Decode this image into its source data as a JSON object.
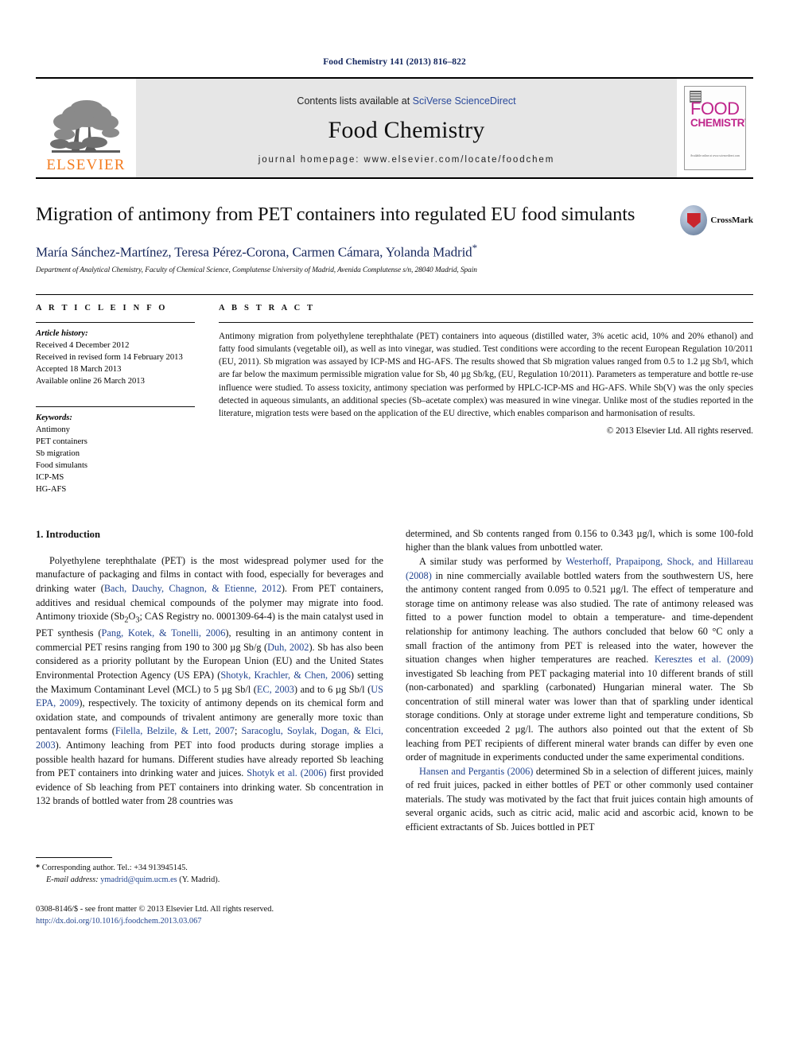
{
  "running_head": "Food Chemistry 141 (2013) 816–822",
  "masthead": {
    "publisher_name": "ELSEVIER",
    "contents_prefix": "Contents lists available at ",
    "contents_link": "SciVerse ScienceDirect",
    "journal_name": "Food Chemistry",
    "homepage": "journal homepage: www.elsevier.com/locate/foodchem",
    "cover": {
      "line1": "FOOD",
      "line2": "CHEMISTRY",
      "footline": "Available online at www.sciencedirect.com"
    }
  },
  "title_block": {
    "title": "Migration of antimony from PET containers into regulated EU food simulants",
    "authors": "María Sánchez-Martínez, Teresa Pérez-Corona, Carmen Cámara, Yolanda Madrid",
    "corresponding_marker": "*",
    "affiliation": "Department of Analytical Chemistry, Faculty of Chemical Science, Complutense University of Madrid, Avenida Complutense s/n, 28040 Madrid, Spain",
    "crossmark_label": "CrossMark"
  },
  "article_info": {
    "heading": "A R T I C L E   I N F O",
    "history_label": "Article history:",
    "history": [
      "Received 4 December 2012",
      "Received in revised form 14 February 2013",
      "Accepted 18 March 2013",
      "Available online 26 March 2013"
    ],
    "keywords_label": "Keywords:",
    "keywords": [
      "Antimony",
      "PET containers",
      "Sb migration",
      "Food simulants",
      "ICP-MS",
      "HG-AFS"
    ]
  },
  "abstract": {
    "heading": "A B S T R A C T",
    "text": "Antimony migration from polyethylene terephthalate (PET) containers into aqueous (distilled water, 3% acetic acid, 10% and 20% ethanol) and fatty food simulants (vegetable oil), as well as into vinegar, was studied. Test conditions were according to the recent European Regulation 10/2011 (EU, 2011). Sb migration was assayed by ICP-MS and HG-AFS. The results showed that Sb migration values ranged from 0.5 to 1.2 µg Sb/l, which are far below the maximum permissible migration value for Sb, 40 µg Sb/kg, (EU, Regulation 10/2011). Parameters as temperature and bottle re-use influence were studied. To assess toxicity, antimony speciation was performed by HPLC-ICP-MS and HG-AFS. While Sb(V) was the only species detected in aqueous simulants, an additional species (Sb–acetate complex) was measured in wine vinegar. Unlike most of the studies reported in the literature, migration tests were based on the application of the EU directive, which enables comparison and harmonisation of results.",
    "copyright": "© 2013 Elsevier Ltd. All rights reserved."
  },
  "body": {
    "section_heading": "1. Introduction",
    "left_col_paragraph": "Polyethylene terephthalate (PET) is the most widespread polymer used for the manufacture of packaging and films in contact with food, especially for beverages and drinking water (Bach, Dauchy, Chagnon, & Etienne, 2012). From PET containers, additives and residual chemical compounds of the polymer may migrate into food. Antimony trioxide (Sb2O3; CAS Registry no. 0001309-64-4) is the main catalyst used in PET synthesis (Pang, Kotek, & Tonelli, 2006), resulting in an antimony content in commercial PET resins ranging from 190 to 300 µg Sb/g (Duh, 2002). Sb has also been considered as a priority pollutant by the European Union (EU) and the United States Environmental Protection Agency (US EPA) (Shotyk, Krachler, & Chen, 2006) setting the Maximum Contaminant Level (MCL) to 5 µg Sb/l (EC, 2003) and to 6 µg Sb/l (US EPA, 2009), respectively. The toxicity of antimony depends on its chemical form and oxidation state, and compounds of trivalent antimony are generally more toxic than pentavalent forms (Filella, Belzile, & Lett, 2007; Saracoglu, Soylak, Dogan, & Elci, 2003). Antimony leaching from PET into food products during storage implies a possible health hazard for humans. Different studies have already reported Sb leaching from PET containers into drinking water and juices. Shotyk et al. (2006) first provided evidence of Sb leaching from PET containers into drinking water. Sb concentration in 132 brands of bottled water from 28 countries was",
    "right_col_paragraph_1": "determined, and Sb contents ranged from 0.156 to 0.343 µg/l, which is some 100-fold higher than the blank values from unbottled water.",
    "right_col_paragraph_2": "A similar study was performed by Westerhoff, Prapaipong, Shock, and Hillareau (2008) in nine commercially available bottled waters from the southwestern US, here the antimony content ranged from 0.095 to 0.521 µg/l. The effect of temperature and storage time on antimony release was also studied. The rate of antimony released was fitted to a power function model to obtain a temperature- and time-dependent relationship for antimony leaching. The authors concluded that below 60 °C only a small fraction of the antimony from PET is released into the water, however the situation changes when higher temperatures are reached. Keresztes et al. (2009) investigated Sb leaching from PET packaging material into 10 different brands of still (non-carbonated) and sparkling (carbonated) Hungarian mineral water. The Sb concentration of still mineral water was lower than that of sparkling under identical storage conditions. Only at storage under extreme light and temperature conditions, Sb concentration exceeded 2 µg/l. The authors also pointed out that the extent of Sb leaching from PET recipients of different mineral water brands can differ by even one order of magnitude in experiments conducted under the same experimental conditions.",
    "right_col_paragraph_3": "Hansen and Pergantis (2006) determined Sb in a selection of different juices, mainly of red fruit juices, packed in either bottles of PET or other commonly used container materials. The study was motivated by the fact that fruit juices contain high amounts of several organic acids, such as citric acid, malic acid and ascorbic acid, known to be efficient extractants of Sb. Juices bottled in PET"
  },
  "footnotes": {
    "corresponding_star": "*",
    "corresponding_text": "Corresponding author. Tel.: +34 913945145.",
    "email_label": "E-mail address:",
    "email": "ymadrid@quim.ucm.es",
    "email_suffix": "(Y. Madrid).",
    "issn_line": "0308-8146/$ - see front matter © 2013 Elsevier Ltd. All rights reserved.",
    "doi": "http://dx.doi.org/10.1016/j.foodchem.2013.03.067"
  },
  "colors": {
    "header_blue": "#13265e",
    "link_blue": "#23458f",
    "elsevier_orange": "#f47c20",
    "cover_magenta": "#c0268c",
    "band_grey": "#e6e6e6"
  }
}
